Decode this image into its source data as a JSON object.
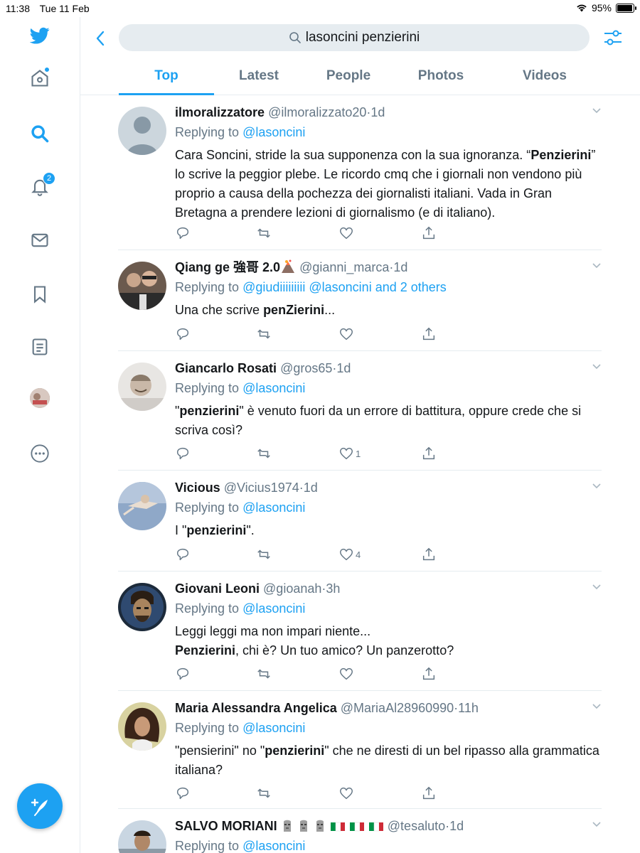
{
  "status": {
    "time": "11:38",
    "date": "Tue 11 Feb",
    "battery": "95%",
    "battery_level": 0.95
  },
  "sidebar": {
    "notifications_count": "2"
  },
  "header": {
    "search_query": "lasoncini penzierini",
    "tabs": [
      {
        "label": "Top"
      },
      {
        "label": "Latest"
      },
      {
        "label": "People"
      },
      {
        "label": "Photos"
      },
      {
        "label": "Videos"
      }
    ]
  },
  "colors": {
    "accent": "#1da1f2",
    "secondary_text": "#657786",
    "border": "#e6ecf0"
  },
  "tweets": [
    {
      "name": "ilmoralizzatore",
      "handle": "@ilmoralizzato20",
      "dot": "·",
      "time": "1d",
      "replying_label": "Replying to",
      "replying_to": "@lasoncini",
      "text_parts": [
        {
          "t": "Cara Soncini, stride la sua supponenza con la sua ignoranza. “",
          "b": false
        },
        {
          "t": "Penzierini",
          "b": true
        },
        {
          "t": "” lo scrive la peggior plebe. Le ricordo cmq che i giornali non vendono più proprio a causa della pochezza dei giornalisti italiani. Vada in Gran Bretagna a prendere lezioni di giornalismo (e di italiano).",
          "b": false
        }
      ],
      "likes": ""
    },
    {
      "name": "Qiang ge 強哥 2.0",
      "handle": "@gianni_marca",
      "dot": "·",
      "time": "1d",
      "replying_label": "Replying to",
      "replying_to": "@giudiiiiiiiii @lasoncini and 2 others",
      "text_parts": [
        {
          "t": "Una che scrive ",
          "b": false
        },
        {
          "t": "penZierini",
          "b": true
        },
        {
          "t": "...",
          "b": false
        }
      ],
      "likes": ""
    },
    {
      "name": "Giancarlo Rosati",
      "handle": "@gros65",
      "dot": "·",
      "time": "1d",
      "replying_label": "Replying to",
      "replying_to": "@lasoncini",
      "text_parts": [
        {
          "t": "\"",
          "b": false
        },
        {
          "t": "penzierini",
          "b": true
        },
        {
          "t": "\" è venuto fuori da un errore di battitura, oppure crede che si scriva così?",
          "b": false
        }
      ],
      "likes": "1"
    },
    {
      "name": "Vicious",
      "handle": "@Vicius1974",
      "dot": "·",
      "time": "1d",
      "replying_label": "Replying to",
      "replying_to": "@lasoncini",
      "text_parts": [
        {
          "t": "I \"",
          "b": false
        },
        {
          "t": "penzierini",
          "b": true
        },
        {
          "t": "\".",
          "b": false
        }
      ],
      "likes": "4"
    },
    {
      "name": "Giovani Leoni",
      "handle": "@gioanah",
      "dot": "·",
      "time": "3h",
      "replying_label": "Replying to",
      "replying_to": "@lasoncini",
      "text_parts": [
        {
          "t": "Leggi leggi ma non impari niente...",
          "b": false
        },
        {
          "t": "\n",
          "b": false
        },
        {
          "t": "Penzierini",
          "b": true
        },
        {
          "t": ", chi è? Un tuo amico? Un panzerotto?",
          "b": false
        }
      ],
      "likes": ""
    },
    {
      "name": "Maria Alessandra Angelica",
      "handle": "@MariaAl28960990",
      "dot": "·",
      "time": "11h",
      "replying_label": "Replying to",
      "replying_to": "@lasoncini",
      "text_parts": [
        {
          "t": "\"pensierini\" no \"",
          "b": false
        },
        {
          "t": "penzierini",
          "b": true
        },
        {
          "t": "\" che ne diresti di un bel ripasso alla grammatica italiana?",
          "b": false
        }
      ],
      "likes": ""
    },
    {
      "name": "SALVO MORIANI",
      "handle": "@tesaluto",
      "dot": "·",
      "time": "1d",
      "replying_label": "Replying to",
      "replying_to": "@lasoncini",
      "text_parts": [],
      "likes": ""
    }
  ]
}
